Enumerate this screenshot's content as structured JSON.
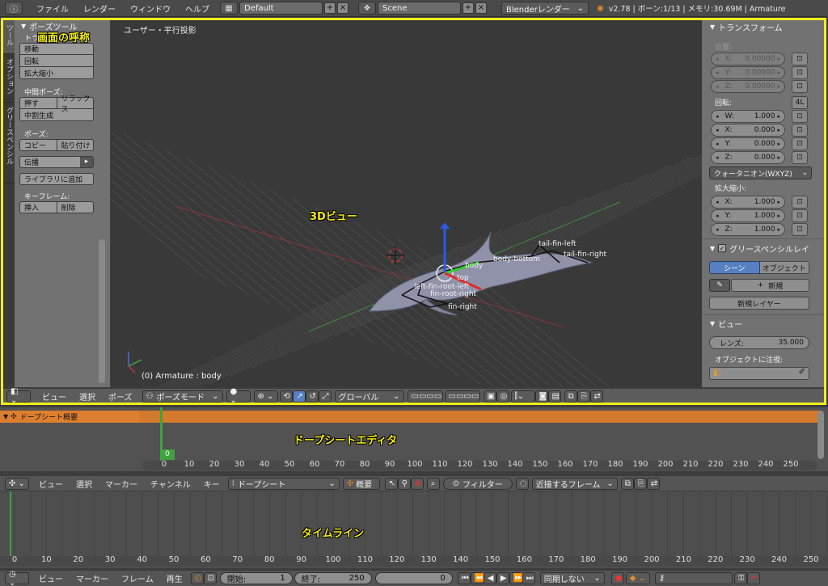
{
  "topbar": {
    "menus": [
      "ファイル",
      "レンダー",
      "ウィンドウ",
      "ヘルプ"
    ],
    "layout_name": "Default",
    "scene_name": "Scene",
    "render_engine": "Blenderレンダー",
    "status": "v2.78 | ボーン:1/13 | メモリ:30.69M | Armature"
  },
  "annotations": {
    "screen_name": "画面の呼称",
    "view3d": "3Dビュー",
    "dopesheet": "ドープシートエディタ",
    "timeline": "タイムライン"
  },
  "tool_tabs": [
    "ツール",
    "オプション",
    "グリースペンシル"
  ],
  "toolshelf": {
    "title": "ポーズツール",
    "transform_label": "トランスフォーム:",
    "transform_buttons": [
      "移動",
      "回転",
      "拡大縮小"
    ],
    "inbetween_label": "中間ポーズ:",
    "push": "押す",
    "relax": "リラックス",
    "breakdown": "中割生成",
    "pose_label": "ポーズ:",
    "copy": "コピー",
    "paste": "貼り付け",
    "propagate": "伝播",
    "add_library": "ライブラリに追加",
    "keyframe_label": "キーフレーム:",
    "insert": "挿入",
    "delete": "削除"
  },
  "viewport": {
    "projection": "ユーザー・平行投影",
    "object_info": "(0) Armature : body",
    "bones": [
      "tail-fin-left",
      "tail-fin-right",
      "body-bottom",
      "body",
      "top",
      "left-fin-root-left",
      "fin-root-right",
      "fin-right"
    ]
  },
  "props": {
    "transform_title": "トランスフォーム",
    "location_label": "位置:",
    "location": [
      {
        "k": "X:",
        "v": "0.00000"
      },
      {
        "k": "Y:",
        "v": "0.00000"
      },
      {
        "k": "Z:",
        "v": "0.00000"
      }
    ],
    "rotation_label": "回転:",
    "rotation_mode_btn": "4L",
    "rotation": [
      {
        "k": "W:",
        "v": "1.000"
      },
      {
        "k": "X:",
        "v": "0.000"
      },
      {
        "k": "Y:",
        "v": "0.000"
      },
      {
        "k": "Z:",
        "v": "0.000"
      }
    ],
    "rotation_mode": "クォータニオン(WXYZ)",
    "scale_label": "拡大縮小:",
    "scale": [
      {
        "k": "X:",
        "v": "1.000"
      },
      {
        "k": "Y:",
        "v": "1.000"
      },
      {
        "k": "Z:",
        "v": "1.000"
      }
    ],
    "gp_title": "グリースペンシルレイ",
    "gp_scene": "シーン",
    "gp_object": "オブジェクト",
    "gp_new": "新規",
    "gp_new_layer": "新規レイヤー",
    "view_title": "ビュー",
    "lens_label": "レンズ:",
    "lens_value": "35.000",
    "lock_object": "オブジェクトに注視:"
  },
  "view3d_header": {
    "menus": [
      "ビュー",
      "選択",
      "ポーズ"
    ],
    "mode": "ポーズモード",
    "orientation": "グローバル"
  },
  "dopesheet": {
    "summary": "ドープシート概要",
    "current_frame": "0",
    "ruler": [
      "0",
      "10",
      "20",
      "30",
      "40",
      "50",
      "60",
      "70",
      "80",
      "90",
      "100",
      "110",
      "120",
      "130",
      "140",
      "150",
      "160",
      "170",
      "180",
      "190",
      "200",
      "210",
      "220",
      "230",
      "240",
      "250"
    ],
    "menus": [
      "ビュー",
      "選択",
      "マーカー",
      "チャンネル",
      "キー"
    ],
    "mode": "ドープシート",
    "summary_btn": "概要",
    "filter": "フィルター",
    "snap": "近接するフレーム"
  },
  "timeline": {
    "ruler": [
      "0",
      "10",
      "20",
      "30",
      "40",
      "50",
      "60",
      "70",
      "80",
      "90",
      "100",
      "110",
      "120",
      "130",
      "140",
      "150",
      "160",
      "170",
      "180",
      "190",
      "200",
      "210",
      "220",
      "230",
      "240",
      "250"
    ],
    "menus": [
      "ビュー",
      "マーカー",
      "フレーム",
      "再生"
    ],
    "start_label": "開始:",
    "start_value": "1",
    "end_label": "終了:",
    "end_value": "250",
    "current": "0",
    "sync": "同期しない"
  },
  "colors": {
    "frame_highlight": "#f2ee1a",
    "dope_summary": "#dd7f2e",
    "current_frame": "#3ea33e",
    "select_blue": "#5680c2"
  }
}
